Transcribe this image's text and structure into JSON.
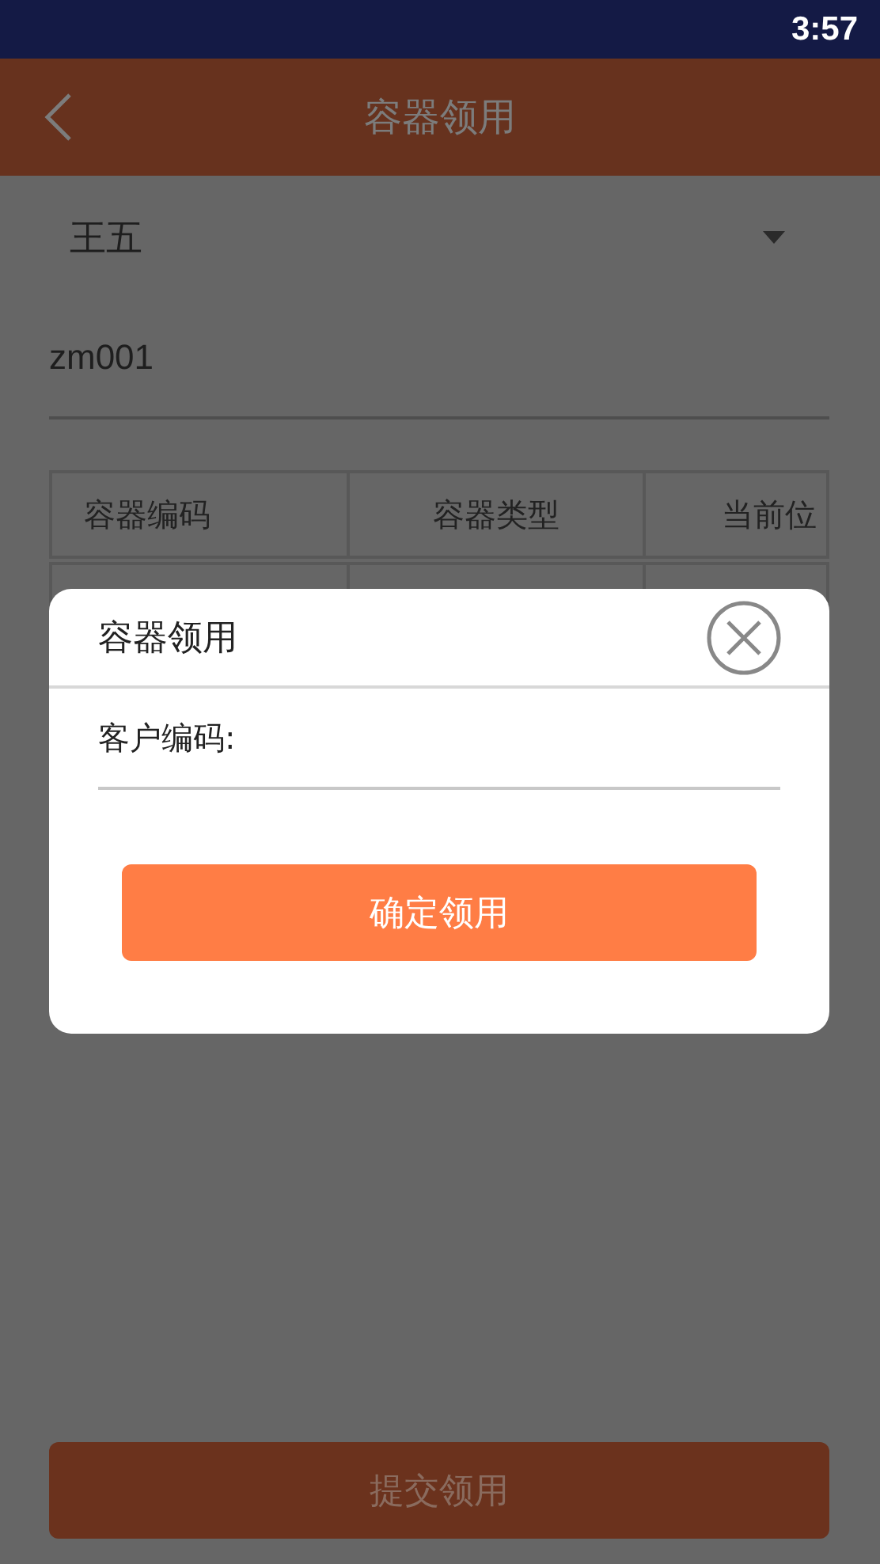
{
  "status_bar": {
    "time": "3:57"
  },
  "header": {
    "title": "容器领用"
  },
  "user_select": {
    "value": "王五"
  },
  "container_code": {
    "value": "zm001"
  },
  "table": {
    "columns": [
      "容器编码",
      "容器类型",
      "当前位"
    ]
  },
  "dialog": {
    "title": "容器领用",
    "field": {
      "label": "客户编码:"
    },
    "confirm_button": "确定领用"
  },
  "submit_button": "提交领用"
}
